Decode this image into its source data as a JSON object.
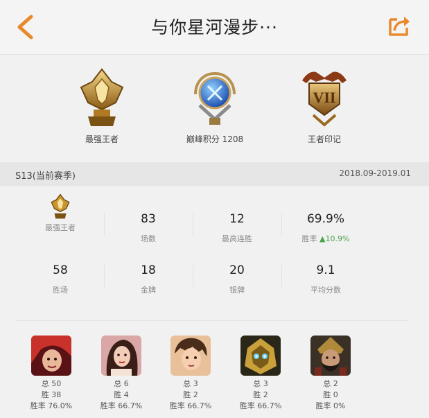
{
  "header": {
    "title": "与你星河漫步···",
    "back_icon": "chevron-left-icon",
    "share_icon": "share-icon",
    "accent": "#e8892b"
  },
  "badges": [
    {
      "label": "最强王者",
      "icon": "king-crest-icon"
    },
    {
      "label": "巅峰积分 1208",
      "icon": "peak-orb-icon"
    },
    {
      "label": "王者印记",
      "icon": "roman-vii-emblem-icon"
    }
  ],
  "season": {
    "name": "S13(当前赛季)",
    "range": "2018.09-2019.01"
  },
  "stats": {
    "rank_label": "最强王者",
    "games": {
      "value": "83",
      "label": "场数"
    },
    "streak": {
      "value": "12",
      "label": "最高连胜"
    },
    "winrate": {
      "value": "69.9%",
      "label": "胜率",
      "delta": "▲10.9%"
    },
    "wins": {
      "value": "58",
      "label": "胜场"
    },
    "gold": {
      "value": "18",
      "label": "金牌"
    },
    "silver": {
      "value": "20",
      "label": "银牌"
    },
    "avg": {
      "value": "9.1",
      "label": "平均分数"
    }
  },
  "heroes": [
    {
      "total": "总 50",
      "wins": "胜 38",
      "rate": "胜率 76.0%",
      "icon": "hero-portrait-red-hair-icon"
    },
    {
      "total": "总 6",
      "wins": "胜 4",
      "rate": "胜率 66.7%",
      "icon": "hero-portrait-lady-icon"
    },
    {
      "total": "总 3",
      "wins": "胜 2",
      "rate": "胜率 66.7%",
      "icon": "hero-portrait-young-man-icon"
    },
    {
      "total": "总 3",
      "wins": "胜 2",
      "rate": "胜率 66.7%",
      "icon": "hero-portrait-golden-armor-icon"
    },
    {
      "total": "总 2",
      "wins": "胜 0",
      "rate": "胜率 0%",
      "icon": "hero-portrait-warrior-icon"
    }
  ]
}
